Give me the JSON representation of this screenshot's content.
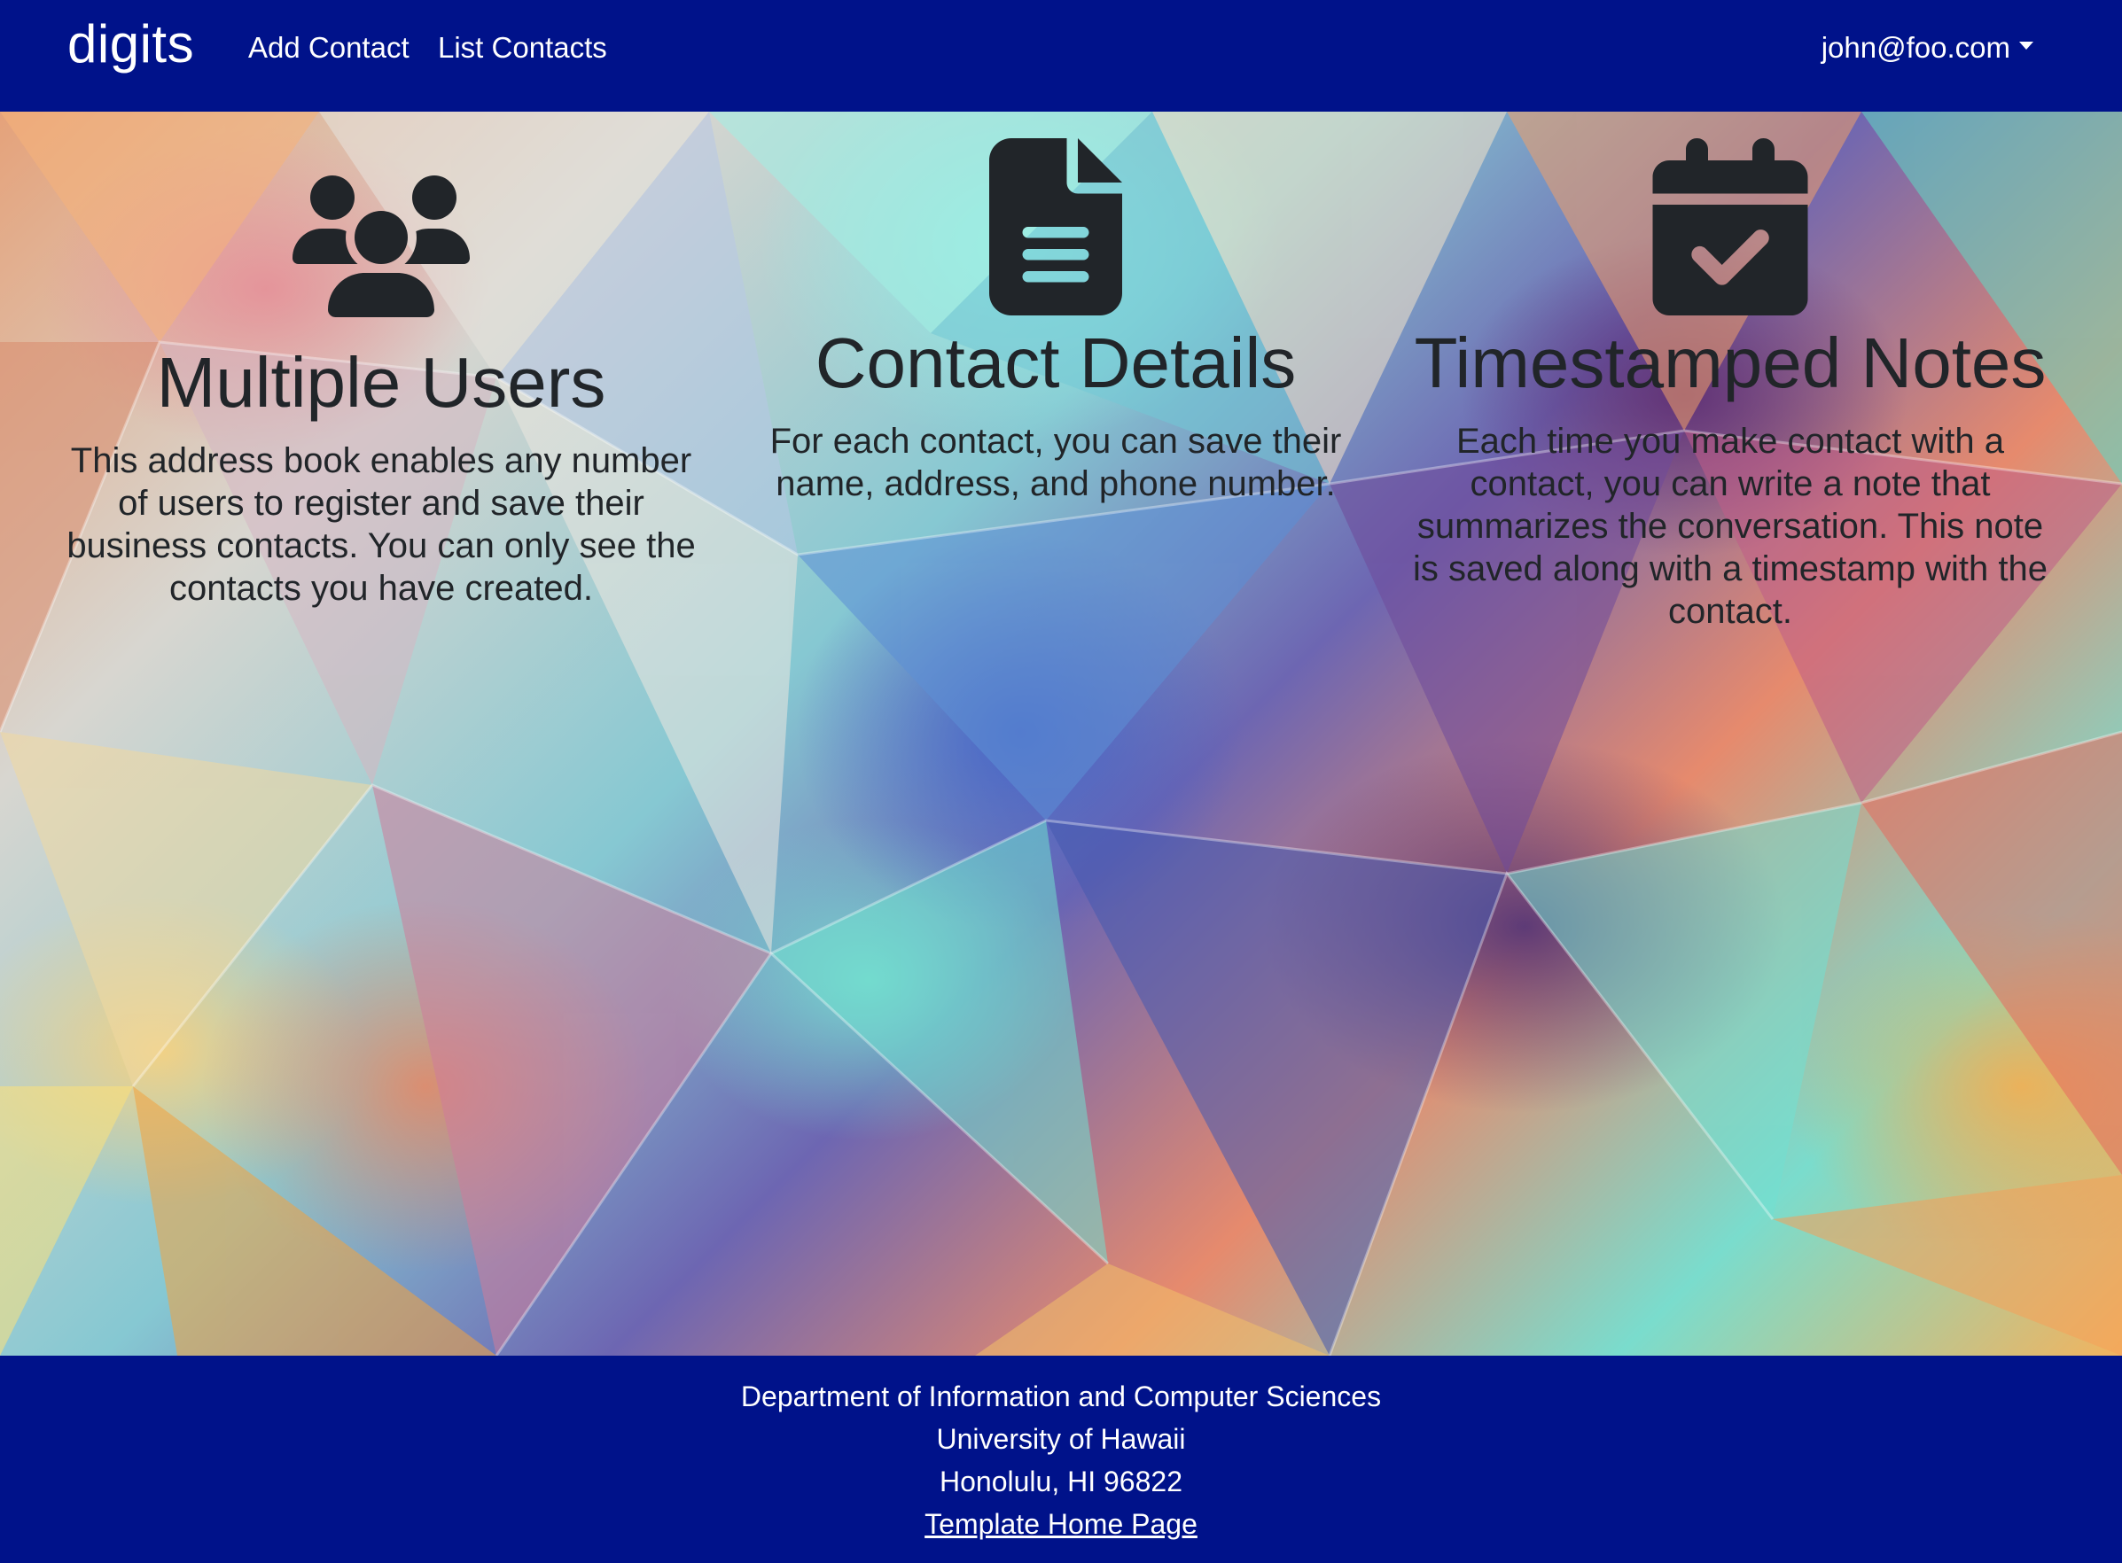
{
  "navbar": {
    "brand": "digits",
    "links": [
      {
        "label": "Add Contact"
      },
      {
        "label": "List Contacts"
      }
    ],
    "user_menu_label": "john@foo.com"
  },
  "features": [
    {
      "icon": "users-icon",
      "title": "Multiple Users",
      "text": "This address book enables any number of users to register and save their business contacts. You can only see the contacts you have created."
    },
    {
      "icon": "file-lines-icon",
      "title": "Contact Details",
      "text": "For each contact, you can save their name, address, and phone number."
    },
    {
      "icon": "calendar-check-icon",
      "title": "Timestamped Notes",
      "text": "Each time you make contact with a contact, you can write a note that summarizes the conversation. This note is saved along with a timestamp with the contact."
    }
  ],
  "footer": {
    "department": "Department of Information and Computer Sciences",
    "university": "University of Hawaii",
    "location": "Honolulu, HI 96822",
    "link_label": "Template Home Page"
  },
  "colors": {
    "navbar_background": "#00128a",
    "text_dark": "#212529",
    "text_light": "#ffffff"
  }
}
